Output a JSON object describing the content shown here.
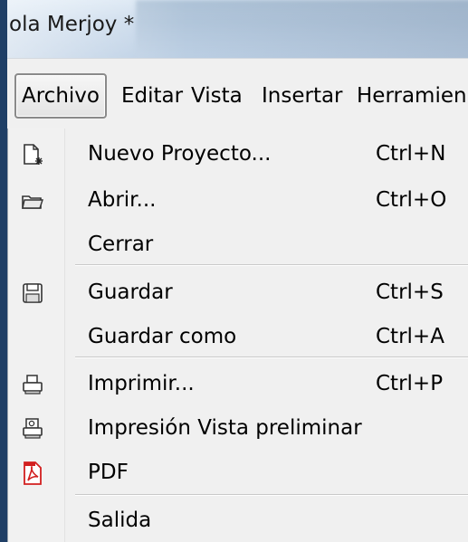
{
  "window": {
    "title": "ola Merjoy *"
  },
  "menubar": {
    "items": [
      {
        "label": "Archivo",
        "active": true
      },
      {
        "label": "Editar",
        "active": false
      },
      {
        "label": "Vista",
        "active": false
      },
      {
        "label": "Insertar",
        "active": false
      },
      {
        "label": "Herramien",
        "active": false
      }
    ]
  },
  "file_menu": {
    "items": [
      {
        "label": "Nuevo Proyecto...",
        "shortcut": "Ctrl+N",
        "icon": "new-document-icon"
      },
      {
        "label": "Abrir...",
        "shortcut": "Ctrl+O",
        "icon": "open-folder-icon"
      },
      {
        "label": "Cerrar",
        "shortcut": "",
        "icon": ""
      },
      {
        "label": "Guardar",
        "shortcut": "Ctrl+S",
        "icon": "floppy-disk-icon"
      },
      {
        "label": "Guardar como",
        "shortcut": "Ctrl+A",
        "icon": ""
      },
      {
        "label": "Imprimir...",
        "shortcut": "Ctrl+P",
        "icon": "printer-icon"
      },
      {
        "label": "Impresión Vista preliminar",
        "shortcut": "",
        "icon": "print-preview-icon"
      },
      {
        "label": "PDF",
        "shortcut": "",
        "icon": "pdf-icon"
      },
      {
        "label": "Salida",
        "shortcut": "",
        "icon": ""
      }
    ]
  },
  "colors": {
    "menu_background": "#f0f0f0",
    "title_bar": "#c7d8ea",
    "window_edge": "#1f3f66",
    "pdf_red": "#d21f1f"
  }
}
